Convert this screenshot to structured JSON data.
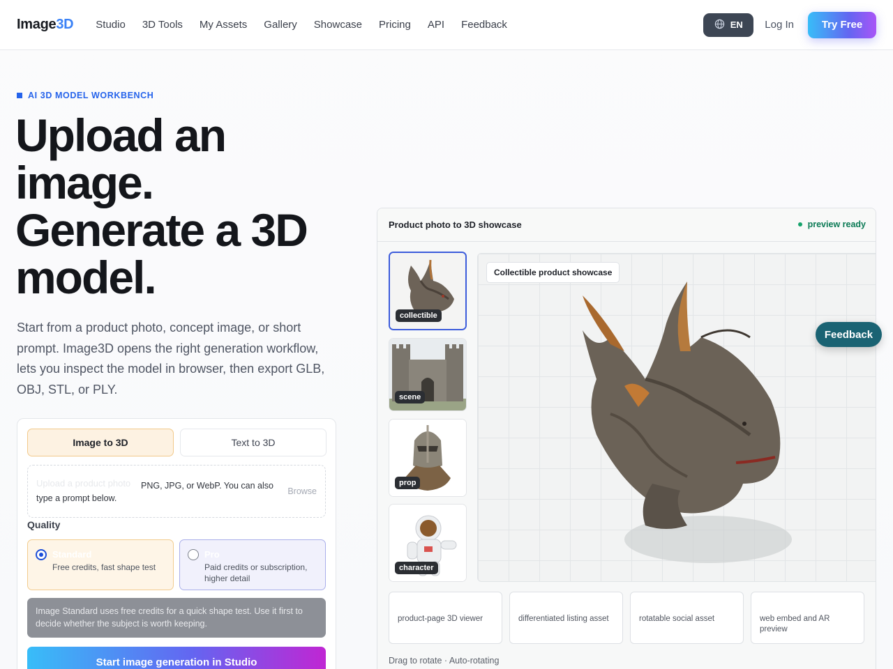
{
  "nav": {
    "logo_main": "Image",
    "logo_accent": "3D",
    "links": [
      "Studio",
      "3D Tools",
      "My Assets",
      "Gallery",
      "Showcase",
      "Pricing",
      "API",
      "Feedback"
    ],
    "language": "EN",
    "login": "Log In",
    "cta": "Try Free"
  },
  "hero": {
    "eyebrow": "AI 3D MODEL WORKBENCH",
    "headline": [
      "Upload an",
      "image.",
      "Generate a 3D",
      "model."
    ],
    "lede": "Start from a product photo, concept image, or short prompt. Image3D opens the right generation workflow, lets you inspect the model in browser, then export GLB, OBJ, STL, or PLY."
  },
  "form": {
    "tabs": [
      {
        "label": "Image to 3D",
        "active": true
      },
      {
        "label": "Text to 3D",
        "active": false
      }
    ],
    "dropzone": {
      "hint": "Upload a product photo",
      "text": "PNG, JPG, or WebP. You can also type a prompt below.",
      "browse": "Browse"
    },
    "quality_label": "Quality",
    "quality_options": [
      {
        "title": "Standard",
        "desc": "Free credits, fast shape test",
        "selected": true
      },
      {
        "title": "Pro",
        "desc": "Paid credits or subscription, higher detail",
        "selected": false
      }
    ],
    "info": "Image Standard uses free credits for a quick shape test. Use it first to decide whether the subject is worth keeping.",
    "start_button": "Start image generation in Studio"
  },
  "showcase": {
    "title": "Product photo to 3D showcase",
    "status": "preview ready",
    "thumbnails": [
      {
        "label": "collectible",
        "selected": true
      },
      {
        "label": "scene",
        "selected": false
      },
      {
        "label": "prop",
        "selected": false
      },
      {
        "label": "character",
        "selected": false
      }
    ],
    "viewer_chip": "Collectible product showcase",
    "use_cases": [
      "product-page 3D viewer",
      "differentiated listing asset",
      "rotatable social asset",
      "web embed and AR preview"
    ],
    "footer": "Drag to rotate · Auto-rotating"
  },
  "feedback_button": "Feedback",
  "colors": {
    "accent_blue": "#2563eb",
    "status_green": "#0b7a55",
    "feedback_teal": "#1a6373"
  },
  "icons": {
    "language": "globe-icon",
    "status": "status-dot-icon"
  }
}
